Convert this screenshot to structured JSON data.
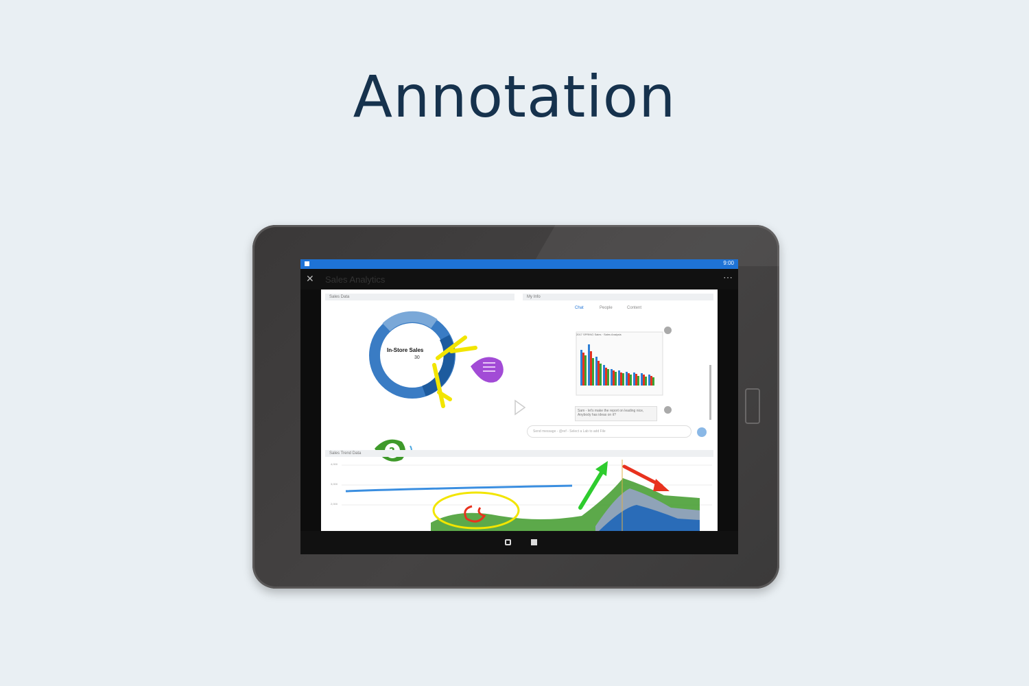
{
  "page": {
    "title": "Annotation"
  },
  "tablet": {
    "status_time": "9:00",
    "app": {
      "title": "Sales Analytics",
      "close_icon": "close-icon",
      "more_icon": "more-icon"
    },
    "dashboard": {
      "donut_panel_title": "Sales Data",
      "donut_label": "In-Store Sales",
      "donut_value": "30",
      "trend_panel_title": "Sales Trend Data",
      "axis_ticks": [
        "4,000",
        "3,000",
        "2,000"
      ]
    },
    "chat": {
      "panel_title": "My Info",
      "tabs": [
        "Chat",
        "People",
        "Content"
      ],
      "card_title": "2017 SPRING Sales · Sales Analysis",
      "message_text": "Sam - let's make the report on leading nice, Anybody has ideas on it?",
      "compose_placeholder": "Send message - @ref - Select a Lab to add File"
    }
  },
  "colors": {
    "accent": "#1e73d6",
    "title": "#16324d",
    "annotation_yellow": "#f2e500",
    "annotation_purple": "#a24bd6",
    "annotation_green": "#3f9a2a",
    "arrow_green": "#2ecc2e",
    "arrow_red": "#e8321e"
  }
}
